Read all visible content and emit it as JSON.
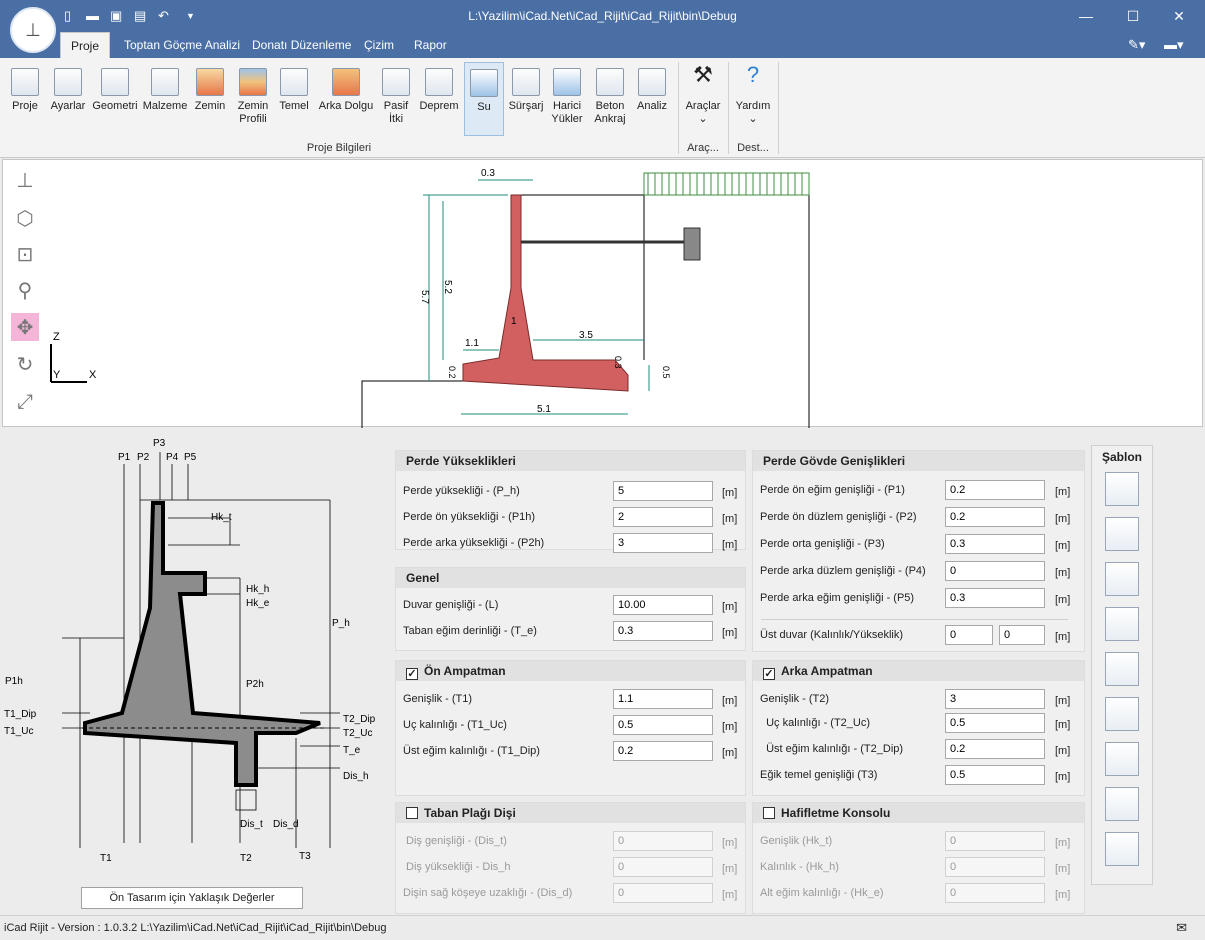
{
  "window": {
    "title": "L:\\Yazilim\\iCad.Net\\iCad_Rijit\\iCad_Rijit\\bin\\Debug"
  },
  "tabs": [
    "Proje",
    "Toptan Göçme Analizi",
    "Donatı Düzenleme",
    "Çizim",
    "Rapor"
  ],
  "ribbon": {
    "buttons": [
      "Proje",
      "Ayarlar",
      "Geometri",
      "Malzeme",
      "Zemin",
      "Zemin Profili",
      "Temel",
      "Arka Dolgu",
      "Pasif İtki",
      "Deprem",
      "Su",
      "Sürşarj",
      "Harici Yükler",
      "Beton Ankraj",
      "Analiz"
    ],
    "tools": [
      "Araçlar",
      "Yardım"
    ],
    "group_labels": [
      "Proje Bilgileri",
      "Araç...",
      "Dest..."
    ]
  },
  "drawing": {
    "dims": [
      "0.3",
      "5.7",
      "5.2",
      "1.1",
      "1",
      "3.5",
      "0.3",
      "0.5",
      "0.2",
      "5.1"
    ],
    "axes": [
      "Z",
      "Y",
      "X"
    ],
    "labels": [
      "P1",
      "P2",
      "P3",
      "P4",
      "P5",
      "Hk_t",
      "Hk_h",
      "Hk_e",
      "P_h",
      "P1h",
      "P2h",
      "T1_Dip",
      "T1_Uc",
      "T2_Dip",
      "T2_Uc",
      "T_e",
      "Dis_h",
      "Dis_t",
      "Dis_d",
      "T1",
      "T2",
      "T3"
    ]
  },
  "preset_button": "Ön Tasarım için Yaklaşık Değerler",
  "perde_yukseklikleri": {
    "title": "Perde Yükseklikleri",
    "fields": [
      {
        "label": "Perde yüksekliği  - (P_h)",
        "value": "5",
        "unit": "[m]"
      },
      {
        "label": "Perde ön yüksekliği - (P1h)",
        "value": "2",
        "unit": "[m]"
      },
      {
        "label": "Perde arka yüksekliği  - (P2h)",
        "value": "3",
        "unit": "[m]"
      }
    ]
  },
  "genel": {
    "title": "Genel",
    "fields": [
      {
        "label": "Duvar genişliği - (L)",
        "value": "10.00",
        "unit": "[m]"
      },
      {
        "label": "Taban eğim derinliği - (T_e)",
        "value": "0.3",
        "unit": "[m]"
      }
    ]
  },
  "on_ampatman": {
    "title": "Ön Ampatman",
    "checked": "✓",
    "fields": [
      {
        "label": "Genişlik - (T1)",
        "value": "1.1",
        "unit": "[m]"
      },
      {
        "label": "Uç kalınlığı - (T1_Uc)",
        "value": "0.5",
        "unit": "[m]"
      },
      {
        "label": "Üst eğim kalınlığı  - (T1_Dip)",
        "value": "0.2",
        "unit": "[m]"
      }
    ]
  },
  "taban_plagi": {
    "title": "Taban Plağı Dişi",
    "checked": "",
    "fields": [
      {
        "label": "Diş genişliği - (Dis_t)",
        "value": "0",
        "unit": "[m]"
      },
      {
        "label": "Diş yüksekliği - Dis_h",
        "value": "0",
        "unit": "[m]"
      },
      {
        "label": "Dişin sağ köşeye uzaklığı - (Dis_d)",
        "value": "0",
        "unit": "[m]"
      }
    ]
  },
  "perde_govde": {
    "title": "Perde Gövde Genişlikleri",
    "fields": [
      {
        "label": "Perde ön eğim genişliği - (P1)",
        "value": "0.2",
        "unit": "[m]"
      },
      {
        "label": "Perde ön düzlem genişliği - (P2)",
        "value": "0.2",
        "unit": "[m]"
      },
      {
        "label": "Perde orta genişliği - (P3)",
        "value": "0.3",
        "unit": "[m]"
      },
      {
        "label": "Perde arka düzlem genişliği - (P4)",
        "value": "0",
        "unit": "[m]"
      },
      {
        "label": "Perde arka eğim genişliği - (P5)",
        "value": "0.3",
        "unit": "[m]"
      }
    ],
    "ust_duvar": {
      "label": "Üst duvar (Kalınlık/Yükseklik)",
      "value1": "0",
      "value2": "0",
      "unit": "[m]"
    }
  },
  "arka_ampatman": {
    "title": "Arka Ampatman",
    "checked": "✓",
    "fields": [
      {
        "label": "Genişlik - (T2)",
        "value": "3",
        "unit": "[m]"
      },
      {
        "label": "  Uç kalınlığı - (T2_Uc)",
        "value": "0.5",
        "unit": "[m]"
      },
      {
        "label": "  Üst eğim kalınlığı - (T2_Dip)",
        "value": "0.2",
        "unit": "[m]"
      },
      {
        "label": "Eğik temel genişliği (T3)",
        "value": "0.5",
        "unit": "[m]"
      }
    ]
  },
  "hafifletme": {
    "title": "Hafifletme Konsolu",
    "checked": "",
    "fields": [
      {
        "label": "Genişlik (Hk_t)",
        "value": "0",
        "unit": "[m]"
      },
      {
        "label": "Kalınlık - (Hk_h)",
        "value": "0",
        "unit": "[m]"
      },
      {
        "label": "Alt eğim kalınlığı - (Hk_e)",
        "value": "0",
        "unit": "[m]"
      }
    ]
  },
  "sablon": {
    "title": "Şablon"
  },
  "status": {
    "text": "iCad Rijit - Version : 1.0.3.2  L:\\Yazilim\\iCad.Net\\iCad_Rijit\\iCad_Rijit\\bin\\Debug"
  },
  "colors": {
    "titlebar": "#4a6fa5",
    "wall_fill": "#d26060",
    "dim": "#1c8c7c",
    "surcharge": "#3f8f3f",
    "diagram_fill": "#8c8c8c"
  }
}
